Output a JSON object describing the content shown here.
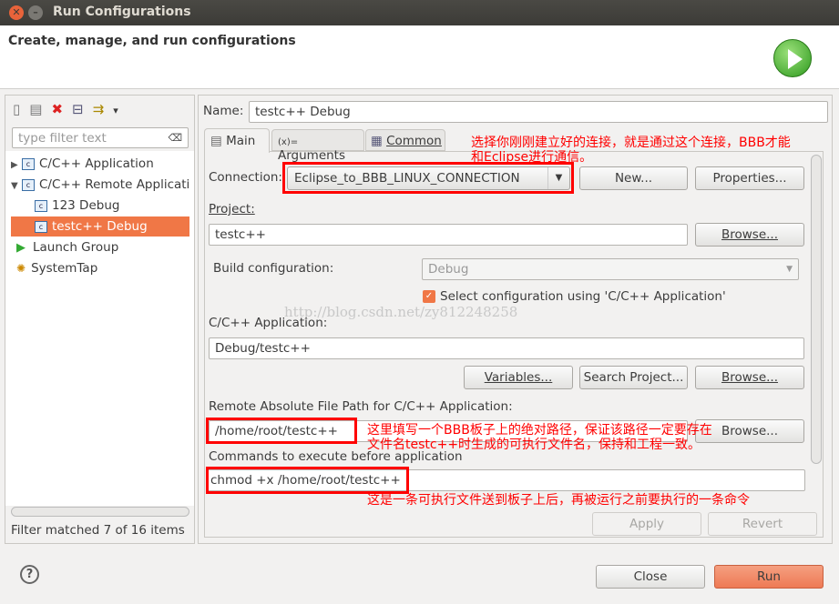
{
  "window": {
    "title": "Run Configurations",
    "close": "✕",
    "minimize": "–"
  },
  "header": {
    "subtitle": "Create, manage, and run configurations"
  },
  "toolbar": {
    "new": "new-config",
    "duplicate": "duplicate",
    "delete": "delete",
    "collapse": "collapse-all",
    "filter": "filter",
    "menu": "▾"
  },
  "sidebar": {
    "filter_placeholder": "type filter text",
    "items": [
      {
        "label": "C/C++ Application",
        "expander": "▶"
      },
      {
        "label": "C/C++ Remote Applicatio",
        "expander": "▼"
      },
      {
        "label": "123 Debug"
      },
      {
        "label": "testc++ Debug"
      },
      {
        "label": "Launch Group"
      },
      {
        "label": "SystemTap"
      }
    ],
    "status": "Filter matched 7 of 16 items"
  },
  "main": {
    "name_label": "Name:",
    "name_value": "testc++ Debug",
    "tabs": [
      {
        "label": "Main"
      },
      {
        "label": "Arguments"
      },
      {
        "label": "Common"
      }
    ],
    "connection_label": "Connection:",
    "connection_value": "Eclipse_to_BBB_LINUX_CONNECTION",
    "new_btn": "New...",
    "properties_btn": "Properties...",
    "project_label": "Project:",
    "project_value": "testc++",
    "browse1": "Browse...",
    "build_label": "Build configuration:",
    "build_value": "Debug",
    "select_config_label": "Select configuration using 'C/C++ Application'",
    "app_label": "C/C++ Application:",
    "app_value": "Debug/testc++",
    "variables_btn": "Variables...",
    "search_btn": "Search Project...",
    "browse2": "Browse...",
    "remote_label": "Remote Absolute File Path for C/C++ Application:",
    "remote_value": "/home/root/testc++",
    "browse3": "Browse...",
    "commands_label": "Commands to execute before application",
    "commands_value": "chmod +x /home/root/testc++",
    "apply_btn": "Apply",
    "revert_btn": "Revert"
  },
  "annotations": {
    "a1_line1": "选择你刚刚建立好的连接，就是通过这个连接，BBB才能",
    "a1_line2": "和Eclipse进行通信。",
    "a2_line1": "这里填写一个BBB板子上的绝对路径，保证该路径一定要存在",
    "a2_line2": "文件名testc++时生成的可执行文件名，保持和工程一致。",
    "a3": "这是一条可执行文件送到板子上后，再被运行之前要执行的一条命令",
    "watermark": "http://blog.csdn.net/zy812248258"
  },
  "footer": {
    "help": "?",
    "close_btn": "Close",
    "run_btn": "Run"
  },
  "colors": {
    "selection": "#f07746",
    "annotation": "#ff0000",
    "run": "#f08a6a"
  }
}
